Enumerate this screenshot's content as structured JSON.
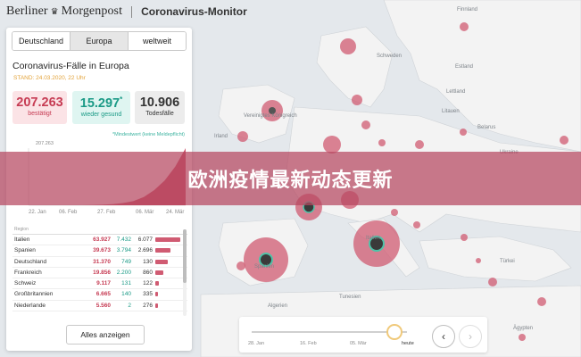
{
  "brand": {
    "logo_left": "Berliner",
    "logo_right": "Morgenpost",
    "title": "Coronavirus-Monitor"
  },
  "tabs": [
    {
      "label": "Deutschland"
    },
    {
      "label": "Europa",
      "active": true
    },
    {
      "label": "weltweit"
    }
  ],
  "panel": {
    "title": "Coronavirus-Fälle in Europa",
    "stand": "STAND: 24.03.2020, 22 Uhr",
    "stats": {
      "confirmed": {
        "value": "207.263",
        "label": "bestätigt"
      },
      "recovered": {
        "value": "15.297",
        "asterisk": "*",
        "label": "wieder gesund"
      },
      "deaths": {
        "value": "10.906",
        "label": "Todesfälle"
      }
    },
    "note": "*Mindestwert (keine Meldepflicht)",
    "show_all": "Alles anzeigen",
    "table_header": "Region",
    "rows": [
      {
        "name": "Italien",
        "confirmed": "63.927",
        "recovered": "7.432",
        "deaths": "6.077",
        "share": 1.0
      },
      {
        "name": "Spanien",
        "confirmed": "39.673",
        "recovered": "3.794",
        "deaths": "2.696",
        "share": 0.62
      },
      {
        "name": "Deutschland",
        "confirmed": "31.370",
        "recovered": "749",
        "deaths": "130",
        "share": 0.49
      },
      {
        "name": "Frankreich",
        "confirmed": "19.856",
        "recovered": "2.200",
        "deaths": "860",
        "share": 0.31
      },
      {
        "name": "Schweiz",
        "confirmed": "9.117",
        "recovered": "131",
        "deaths": "122",
        "share": 0.14
      },
      {
        "name": "Großbritannien",
        "confirmed": "6.665",
        "recovered": "140",
        "deaths": "335",
        "share": 0.1
      },
      {
        "name": "Niederlande",
        "confirmed": "5.560",
        "recovered": "2",
        "deaths": "276",
        "share": 0.09
      }
    ]
  },
  "chart_data": {
    "type": "area",
    "y_max_label": "207.263",
    "x_ticks": [
      "22. Jan",
      "06. Feb",
      "27. Feb",
      "05. Mär",
      "24. Mär"
    ],
    "x_labels_visible": [
      "22. Jan",
      "06. Feb",
      "27. Feb",
      "06. Mär",
      "24. Mär"
    ],
    "series": [
      {
        "values": [
          0,
          0,
          0,
          0,
          0,
          0,
          1,
          2,
          4,
          8,
          15,
          30,
          55,
          90,
          140,
          207
        ]
      }
    ]
  },
  "timeline": {
    "labels": [
      "28. Jan",
      "16. Feb",
      "05. Mär"
    ],
    "today": "heute",
    "position": 0.92
  },
  "banner": {
    "text": "欧洲疫情最新动态更新"
  },
  "map_labels": [
    "Finnland",
    "Schweden",
    "Estland",
    "Lettland",
    "Litauen",
    "Vereinigtes Königreich",
    "Irland",
    "Belarus",
    "Ukraine",
    "Spanien",
    "Italien",
    "Algerien",
    "Tunesien",
    "Ägypten",
    "Türkei"
  ],
  "colors": {
    "confirmed": "#c63b53",
    "recovered": "#1a9a86",
    "banner": "#b54660",
    "bubble": "#d05b72"
  }
}
